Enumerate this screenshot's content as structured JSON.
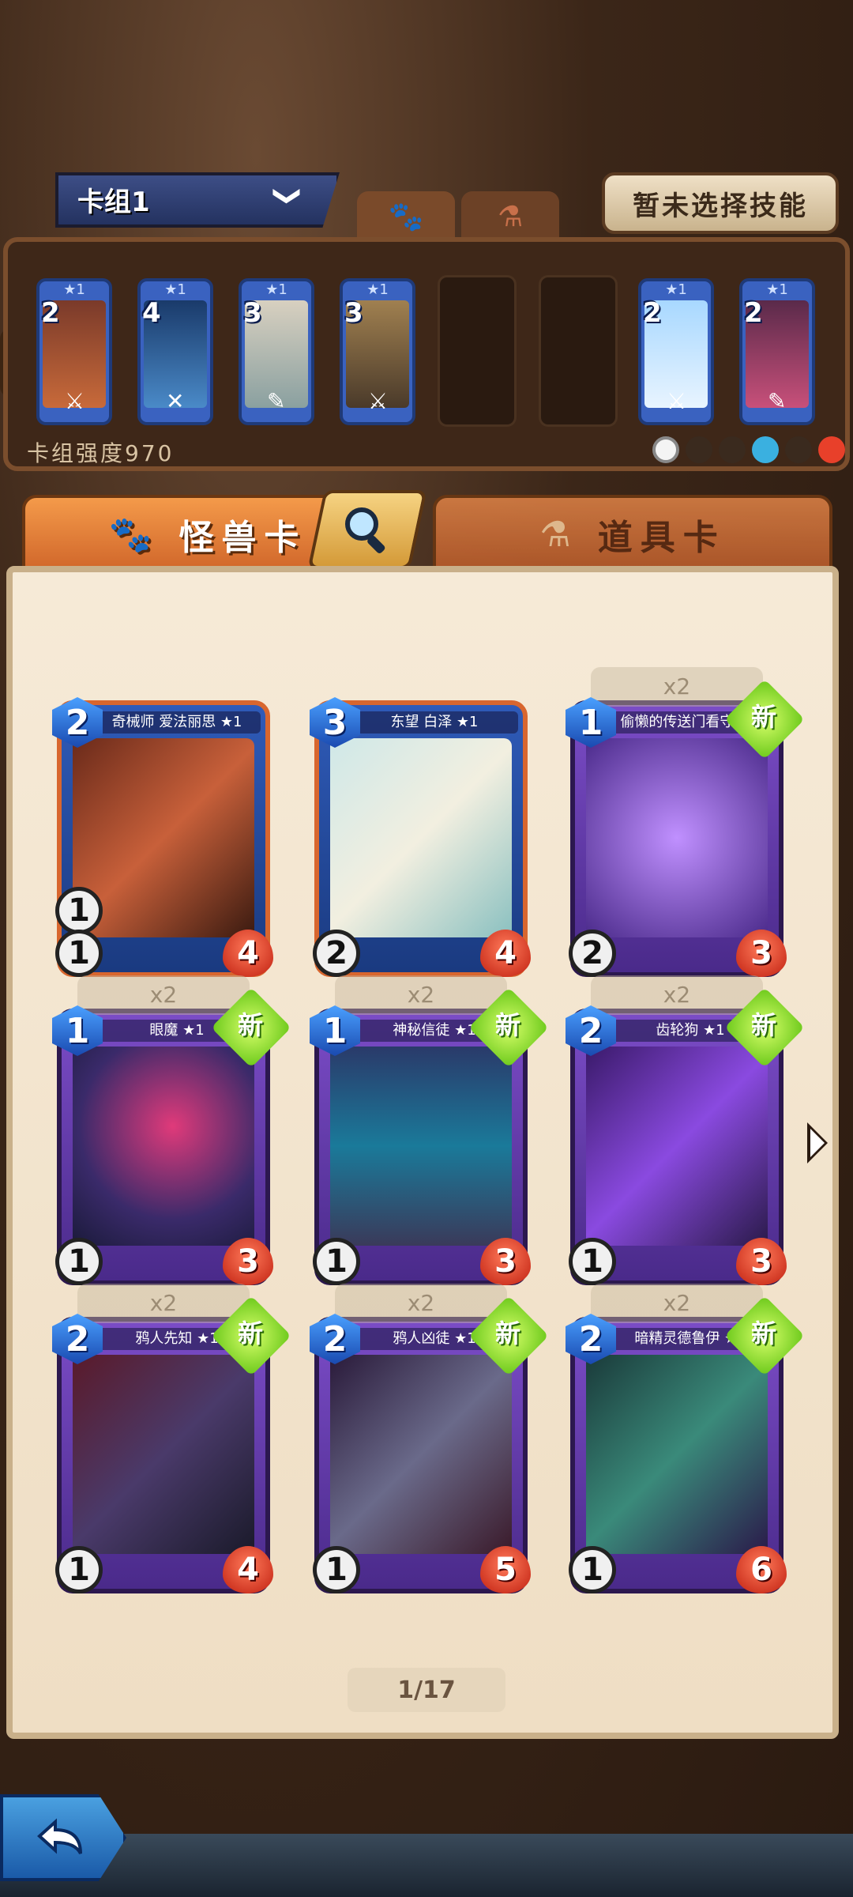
{
  "header": {
    "deck_name": "卡组1",
    "deck_chevron": "❯",
    "skill_button": "暂未选择技能"
  },
  "deck": {
    "strength_label": "卡组强度970",
    "cards": [
      {
        "cost": "2",
        "stars": "★1"
      },
      {
        "cost": "4",
        "stars": "★1"
      },
      {
        "cost": "3",
        "stars": "★1"
      },
      {
        "cost": "3",
        "stars": "★1"
      },
      {
        "cost": "2",
        "stars": "★1"
      },
      {
        "cost": "2",
        "stars": "★1"
      }
    ]
  },
  "tabs": {
    "monster": "怪兽卡",
    "item": "道具卡"
  },
  "cards": [
    {
      "title": "奇械师 爱法丽思 ★1",
      "cost": "2",
      "atk": "1",
      "atk2": "1",
      "hp": "4",
      "count": "",
      "new": "",
      "rank_l": "2",
      "rank_r": "2",
      "tag": "1"
    },
    {
      "title": "东望 白泽 ★1",
      "cost": "3",
      "atk": "2",
      "atk2": "",
      "hp": "4",
      "count": "",
      "new": "",
      "rank_l": "3",
      "rank_r": "2",
      "tag": "1"
    },
    {
      "title": "偷懒的传送门看守 ★1",
      "cost": "1",
      "atk": "2",
      "atk2": "",
      "hp": "3",
      "count": "x2",
      "new": "新"
    },
    {
      "title": "眼魔 ★1",
      "cost": "1",
      "atk": "1",
      "atk2": "",
      "hp": "3",
      "count": "x2",
      "new": "新"
    },
    {
      "title": "神秘信徒 ★1",
      "cost": "1",
      "atk": "1",
      "atk2": "",
      "hp": "3",
      "count": "x2",
      "new": "新"
    },
    {
      "title": "齿轮狗 ★1",
      "cost": "2",
      "atk": "1",
      "atk2": "",
      "hp": "3",
      "count": "x2",
      "new": "新"
    },
    {
      "title": "鸦人先知 ★1",
      "cost": "2",
      "atk": "1",
      "atk2": "",
      "hp": "4",
      "count": "x2",
      "new": "新",
      "center": "1"
    },
    {
      "title": "鸦人凶徒 ★1",
      "cost": "2",
      "atk": "1",
      "atk2": "",
      "hp": "5",
      "count": "x2",
      "new": "新"
    },
    {
      "title": "暗精灵德鲁伊 ★1",
      "cost": "2",
      "atk": "1",
      "atk2": "",
      "hp": "6",
      "count": "x2",
      "new": "新",
      "center": "1"
    }
  ],
  "pagination": {
    "label": "1/17"
  },
  "colors": {
    "monster_tab": "#e07a38",
    "blue_card": "#2f5bb8",
    "purple_card": "#6a3fb8",
    "new_badge": "#8ee02a",
    "hp_red": "#d03a22"
  }
}
